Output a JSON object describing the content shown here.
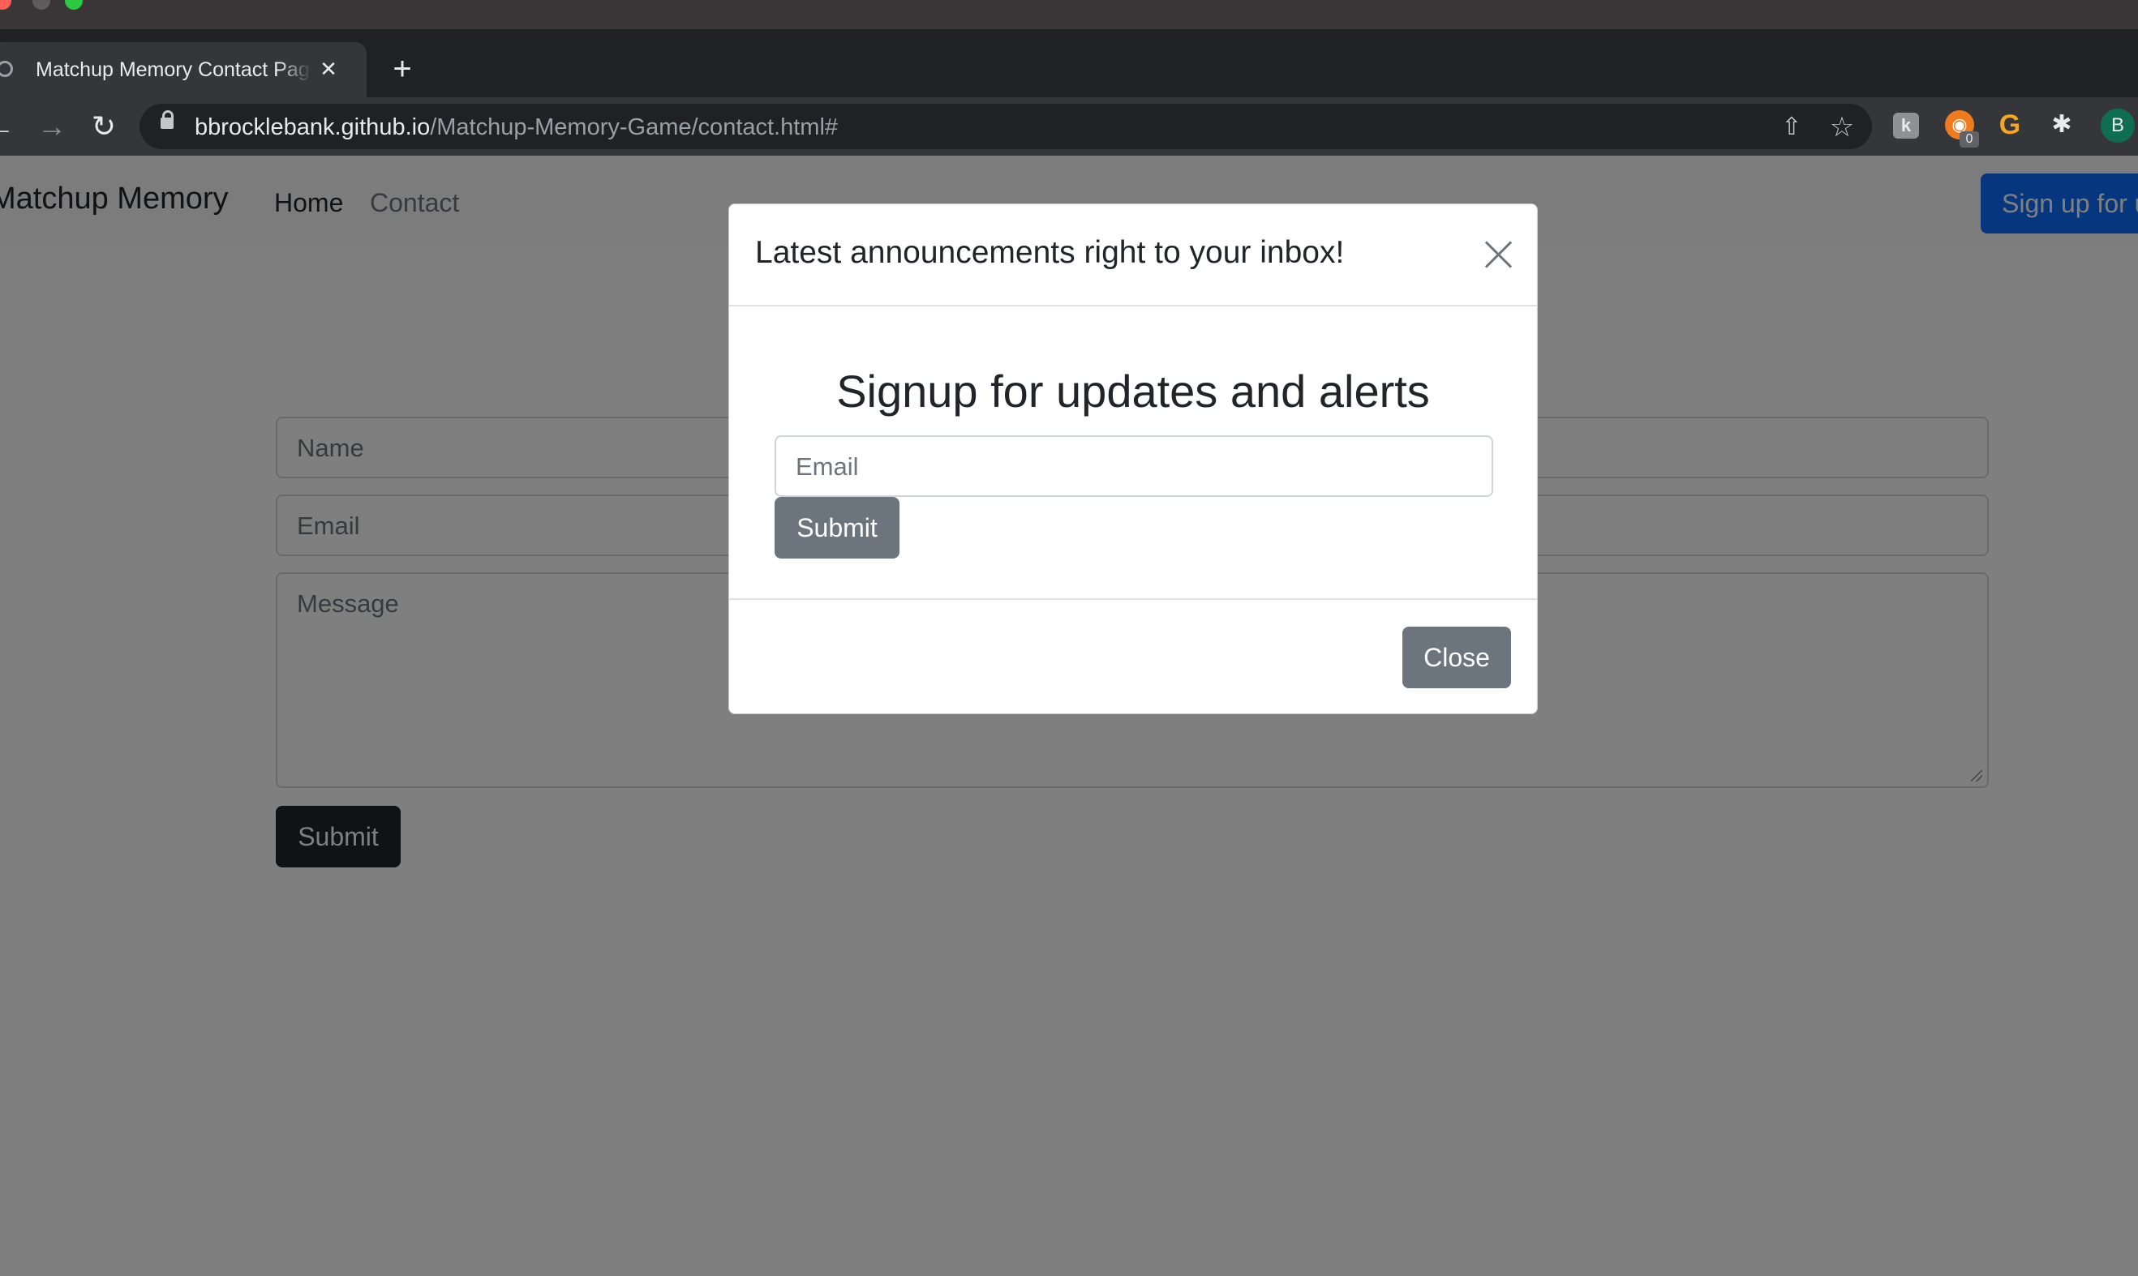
{
  "browser": {
    "tab_title": "Matchup Memory Contact Page",
    "tab_close": "✕",
    "new_tab": "+",
    "url_host": "bbrocklebank.github.io",
    "url_path": "/Matchup-Memory-Game/contact.html#",
    "extension_badge": "0",
    "extension_k": "k",
    "profile_initial": "B",
    "icons": {
      "back": "arrow-left-icon",
      "forward": "arrow-right-icon",
      "reload": "reload-icon",
      "lock": "lock-icon",
      "share": "share-icon",
      "bookmark": "star-icon",
      "extensions": "puzzle-icon"
    }
  },
  "navbar": {
    "brand": "Matchup Memory",
    "links": [
      "Home",
      "Contact"
    ],
    "signup_button": "Sign up for updates"
  },
  "contact_form": {
    "name_placeholder": "Name",
    "email_placeholder": "Email",
    "message_placeholder": "Message",
    "submit_label": "Submit"
  },
  "modal": {
    "title": "Latest announcements right to your inbox!",
    "heading": "Signup for updates and alerts",
    "email_placeholder": "Email",
    "submit_label": "Submit",
    "close_label": "Close"
  },
  "colors": {
    "primary": "#0d6efd",
    "secondary": "#6c757d",
    "dark": "#212529",
    "backdrop": "rgba(0,0,0,0.5)"
  }
}
